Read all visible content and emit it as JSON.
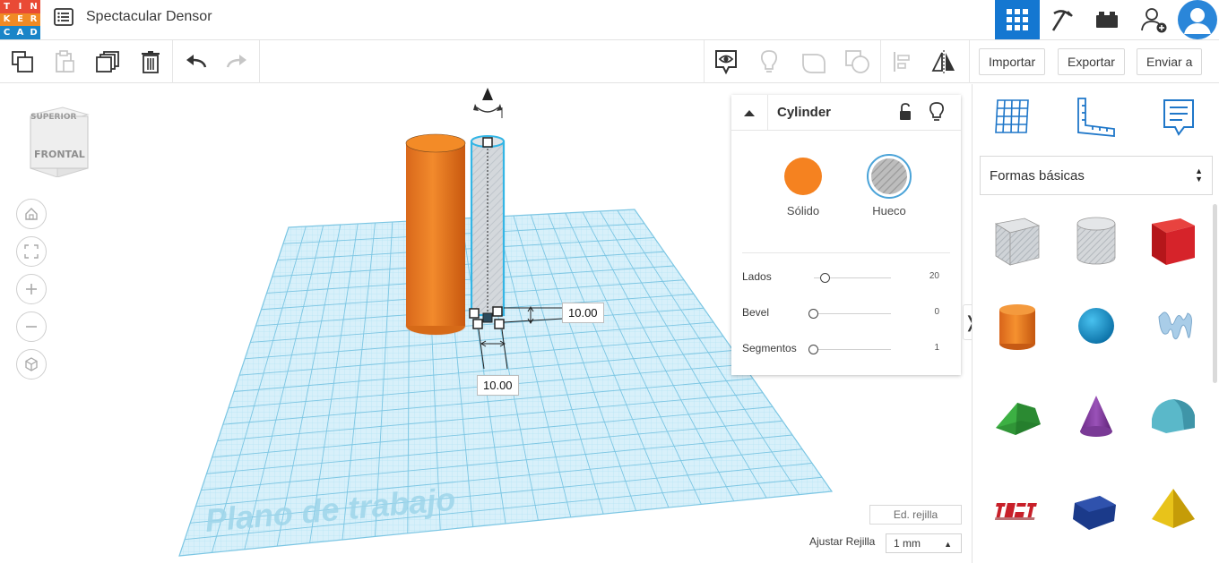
{
  "app": {
    "logo_letters": [
      "T",
      "I",
      "N",
      "K",
      "E",
      "R",
      "C",
      "A",
      "D"
    ],
    "logo_colors": [
      "#e94a35",
      "#e94a35",
      "#e94a35",
      "#f08a24",
      "#f08a24",
      "#f08a24",
      "#1a85c8",
      "#1a85c8",
      "#1a85c8"
    ],
    "design_title": "Spectacular Densor",
    "accent": "#1477d1"
  },
  "topbar": {
    "menu_icon": "list-icon",
    "right_buttons": [
      "grid-view-icon",
      "pickaxe-icon",
      "bricks-icon",
      "add-user-icon",
      "avatar-icon"
    ]
  },
  "toolbar": {
    "left_icons": [
      "copy-icon",
      "paste-icon",
      "duplicate-icon",
      "delete-icon",
      "undo-icon",
      "redo-icon"
    ],
    "right_icons": [
      "show-all-icon",
      "light-bulb-icon",
      "group-icon",
      "ungroup-icon",
      "align-icon",
      "mirror-icon"
    ],
    "import_label": "Importar",
    "export_label": "Exportar",
    "send_label": "Enviar a"
  },
  "viewcube": {
    "top_label": "SUPERIOR",
    "front_label": "FRONTAL"
  },
  "nav_controls": [
    "home-icon",
    "fit-icon",
    "zoom-in-icon",
    "zoom-out-icon",
    "perspective-icon"
  ],
  "workplane": {
    "label": "Plano de trabajo",
    "dim_width": "10.00",
    "dim_depth": "10.00",
    "edit_grid_label": "Ed. rejilla",
    "snap_label": "Ajustar Rejilla",
    "snap_value": "1 mm",
    "solid_color": "#f07f1c",
    "grid_color": "#8fd3ee"
  },
  "inspector": {
    "title": "Cylinder",
    "solid_label": "Sólido",
    "hole_label": "Hueco",
    "solid_color": "#f58220",
    "props": [
      {
        "label": "Lados",
        "value": "20",
        "level": 0.1
      },
      {
        "label": "Bevel",
        "value": "0",
        "level": 0.0
      },
      {
        "label": "Segmentos",
        "value": "1",
        "level": 0.0
      }
    ]
  },
  "sidepanel": {
    "top_icons": [
      "workplane-icon",
      "ruler-icon",
      "notes-icon"
    ],
    "category": "Formas básicas",
    "toggle_glyph": "❭",
    "shapes": [
      "box-hole-icon",
      "cylinder-hole-icon",
      "box-icon",
      "cylinder-icon",
      "sphere-icon",
      "scribble-icon",
      "roof-icon",
      "cone-icon",
      "round-roof-icon",
      "text-icon",
      "polygon-icon",
      "pyramid-icon"
    ]
  }
}
